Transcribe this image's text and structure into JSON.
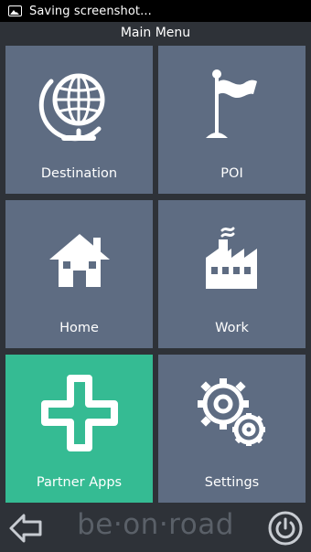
{
  "status_bar": {
    "text": "Saving screenshot...",
    "icon": "image-icon"
  },
  "header": {
    "title": "Main Menu"
  },
  "tiles": [
    {
      "label": "Destination",
      "icon": "globe-icon",
      "color": "#5e6c82"
    },
    {
      "label": "POI",
      "icon": "flag-icon",
      "color": "#5e6c82"
    },
    {
      "label": "Home",
      "icon": "house-icon",
      "color": "#5e6c82"
    },
    {
      "label": "Work",
      "icon": "factory-icon",
      "color": "#5e6c82"
    },
    {
      "label": "Partner Apps",
      "icon": "plus-icon",
      "color": "#35bb93"
    },
    {
      "label": "Settings",
      "icon": "gears-icon",
      "color": "#5e6c82"
    }
  ],
  "footer": {
    "brand": "be·on·road",
    "back_icon": "arrow-left-icon",
    "power_icon": "power-icon"
  },
  "colors": {
    "background": "#2e3238",
    "tile": "#5e6c82",
    "accent": "#35bb93",
    "brand": "#5a6068"
  }
}
